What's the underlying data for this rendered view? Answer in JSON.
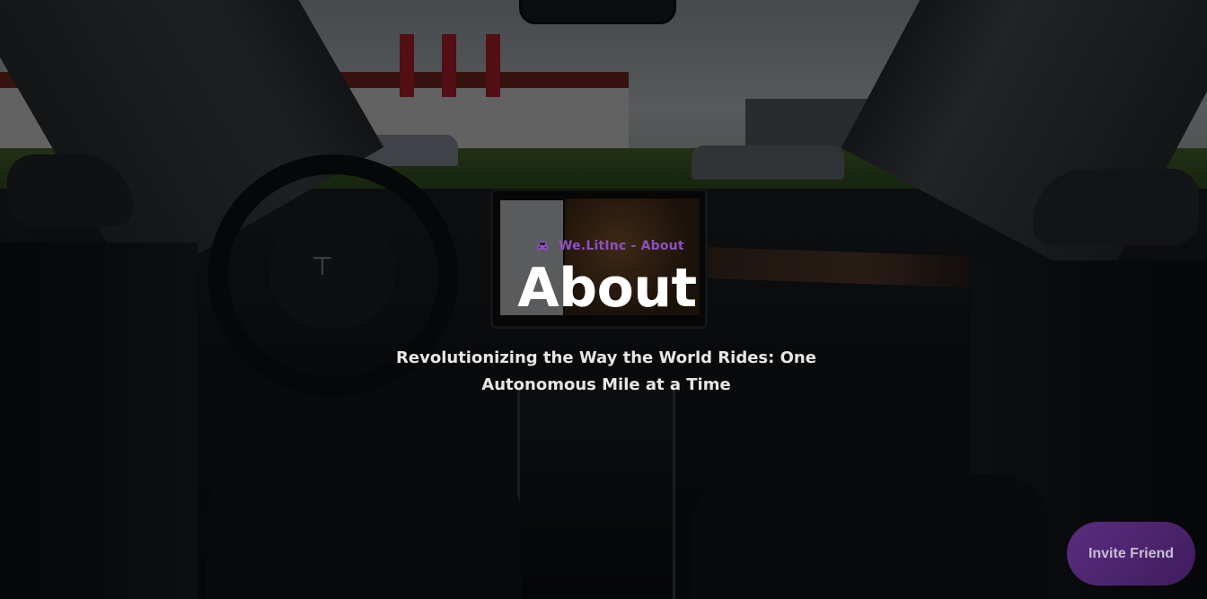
{
  "hero": {
    "breadcrumb": "We.LitInc - About",
    "breadcrumb_icon": "car-icon",
    "title": "About",
    "subtitle": "Revolutionizing the Way the World Rides: One Autonomous Mile at a Time"
  },
  "floating_button": {
    "label": "Invite Friend"
  },
  "colors": {
    "accent": "#8e4fc2",
    "button_bg": "#4a2368",
    "title": "#ffffff",
    "subtitle": "#e6e6e6"
  }
}
